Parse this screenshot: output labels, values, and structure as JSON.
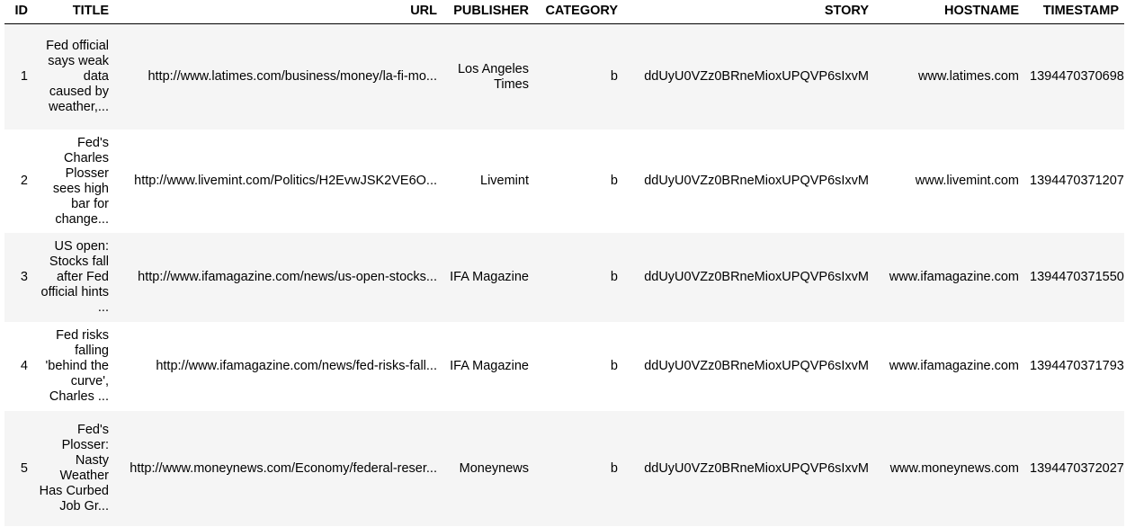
{
  "headers": {
    "id": "ID",
    "title": "TITLE",
    "url": "URL",
    "publisher": "PUBLISHER",
    "category": "CATEGORY",
    "story": "STORY",
    "hostname": "HOSTNAME",
    "timestamp": "TIMESTAMP"
  },
  "rows": [
    {
      "id": "1",
      "title": "Fed official says weak data caused by weather,...",
      "url": "http://www.latimes.com/business/money/la-fi-mo...",
      "publisher": "Los Angeles Times",
      "category": "b",
      "story": "ddUyU0VZz0BRneMioxUPQVP6sIxvM",
      "hostname": "www.latimes.com",
      "timestamp": "1394470370698"
    },
    {
      "id": "2",
      "title": "Fed's Charles Plosser sees high bar for change...",
      "url": "http://www.livemint.com/Politics/H2EvwJSK2VE6O...",
      "publisher": "Livemint",
      "category": "b",
      "story": "ddUyU0VZz0BRneMioxUPQVP6sIxvM",
      "hostname": "www.livemint.com",
      "timestamp": "1394470371207"
    },
    {
      "id": "3",
      "title": "US open: Stocks fall after Fed official hints ...",
      "url": "http://www.ifamagazine.com/news/us-open-stocks...",
      "publisher": "IFA Magazine",
      "category": "b",
      "story": "ddUyU0VZz0BRneMioxUPQVP6sIxvM",
      "hostname": "www.ifamagazine.com",
      "timestamp": "1394470371550"
    },
    {
      "id": "4",
      "title": "Fed risks falling 'behind the curve', Charles ...",
      "url": "http://www.ifamagazine.com/news/fed-risks-fall...",
      "publisher": "IFA Magazine",
      "category": "b",
      "story": "ddUyU0VZz0BRneMioxUPQVP6sIxvM",
      "hostname": "www.ifamagazine.com",
      "timestamp": "1394470371793"
    },
    {
      "id": "5",
      "title": "Fed's Plosser: Nasty Weather Has Curbed Job Gr...",
      "url": "http://www.moneynews.com/Economy/federal-reser...",
      "publisher": "Moneynews",
      "category": "b",
      "story": "ddUyU0VZz0BRneMioxUPQVP6sIxvM",
      "hostname": "www.moneynews.com",
      "timestamp": "1394470372027"
    }
  ]
}
